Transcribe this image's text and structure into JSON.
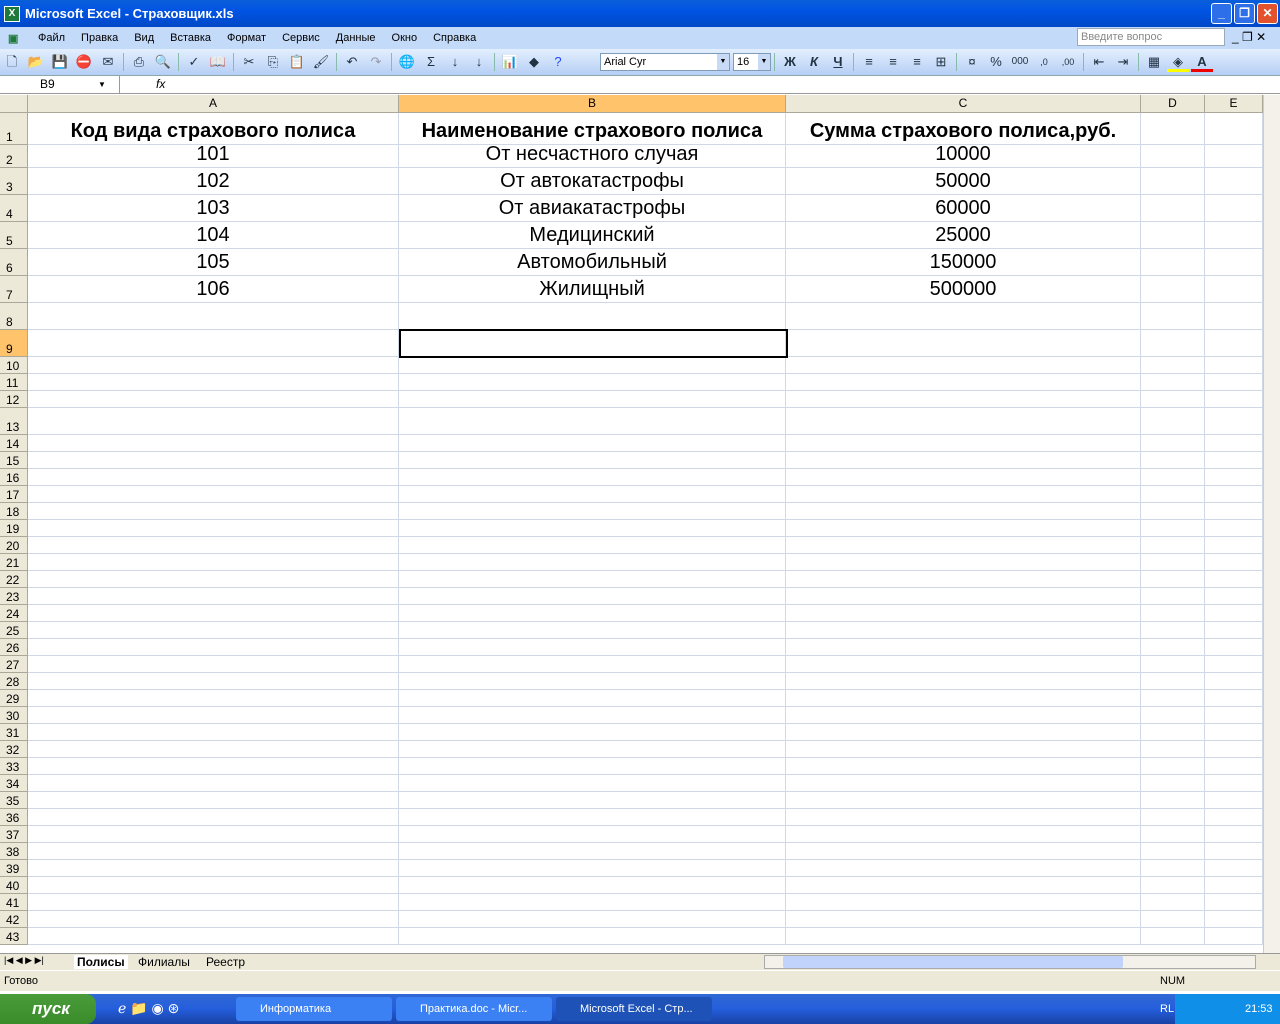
{
  "window": {
    "title": "Microsoft Excel - Страховщик.xls"
  },
  "menu": [
    "Файл",
    "Правка",
    "Вид",
    "Вставка",
    "Формат",
    "Сервис",
    "Данные",
    "Окно",
    "Справка"
  ],
  "ask_placeholder": "Введите вопрос",
  "format": {
    "font": "Arial Cyr",
    "size": "16",
    "bold": "Ж",
    "italic": "К",
    "underline": "Ч"
  },
  "namebox": "B9",
  "fx": "fx",
  "columns": [
    "A",
    "B",
    "C",
    "D",
    "E"
  ],
  "selected_cell": "B9",
  "rows": [
    [
      "Код вида страхового полиса",
      "Наименование страхового полиса",
      "Сумма страхового полиса,руб."
    ],
    [
      "101",
      "От несчастного случая",
      "10000"
    ],
    [
      "102",
      "От автокатастрофы",
      "50000"
    ],
    [
      "103",
      "От авиакатастрофы",
      "60000"
    ],
    [
      "104",
      "Медицинский",
      "25000"
    ],
    [
      "105",
      "Автомобильный",
      "150000"
    ],
    [
      "106",
      "Жилищный",
      "500000"
    ]
  ],
  "row_count": 43,
  "sheets": [
    "Полисы",
    "Филиалы",
    "Реестр"
  ],
  "active_sheet": "Полисы",
  "status": {
    "ready": "Готово",
    "num": "NUM"
  },
  "taskbar": {
    "start": "пуск",
    "tasks": [
      "Информатика",
      "Практика.doc - Micr...",
      "Microsoft Excel - Стр..."
    ],
    "lang": "RL",
    "clock": "21:53"
  }
}
